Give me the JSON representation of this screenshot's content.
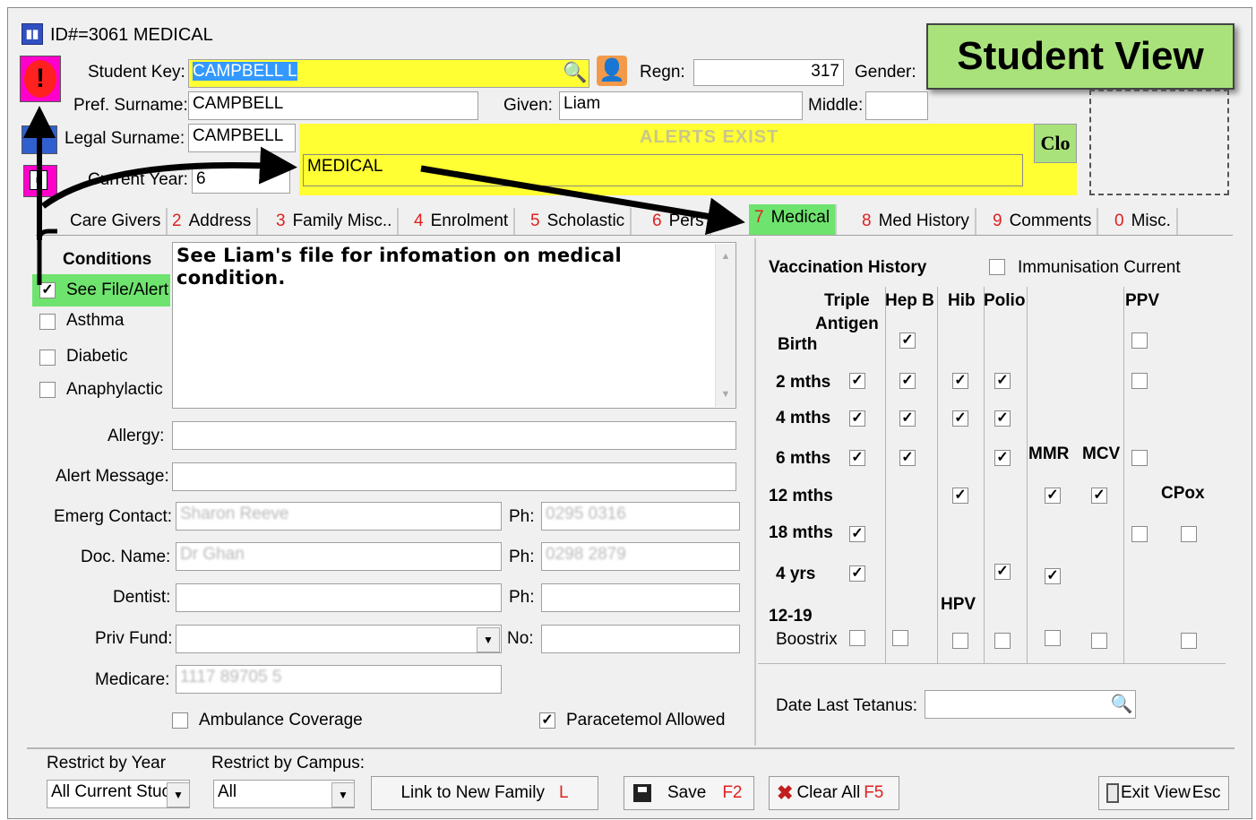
{
  "window": {
    "title": "ID#=3061 MEDICAL"
  },
  "callout": {
    "text": "Student View"
  },
  "header": {
    "student_key_label": "Student Key:",
    "student_key_value": "CAMPBELL L",
    "regn_label": "Regn:",
    "regn_value": "317",
    "gender_label": "Gender:",
    "pref_surname_label": "Pref. Surname:",
    "pref_surname_value": "CAMPBELL",
    "given_label": "Given:",
    "given_value": "Liam",
    "middle_label": "Middle:",
    "legal_surname_label": "Legal Surname:",
    "legal_surname_value": "CAMPBELL",
    "current_year_label": "Current Year:",
    "current_year_value": "6",
    "alerts_label": "ALERTS EXIST",
    "alert_value": "MEDICAL",
    "close_label": "Clo"
  },
  "tabs": [
    {
      "num": "",
      "label": "Care Givers"
    },
    {
      "num": "2",
      "label": "Address"
    },
    {
      "num": "3",
      "label": "Family Misc.."
    },
    {
      "num": "4",
      "label": "Enrolment"
    },
    {
      "num": "5",
      "label": "Scholastic"
    },
    {
      "num": "6",
      "label": "Pers"
    },
    {
      "num": "7",
      "label": "Medical"
    },
    {
      "num": "8",
      "label": "Med History"
    },
    {
      "num": "9",
      "label": "Comments"
    },
    {
      "num": "0",
      "label": "Misc."
    }
  ],
  "conditions": {
    "title": "Conditions",
    "notes": "See Liam's file for infomation on medical condition.",
    "items": [
      {
        "label": "See File/Alert",
        "checked": true
      },
      {
        "label": "Asthma",
        "checked": false
      },
      {
        "label": "Diabetic",
        "checked": false
      },
      {
        "label": "Anaphylactic",
        "checked": false
      }
    ]
  },
  "form": {
    "allergy_label": "Allergy:",
    "alert_message_label": "Alert Message:",
    "emerg_contact_label": "Emerg Contact:",
    "emerg_contact_value": "Sharon Reeve",
    "ph_label": "Ph:",
    "emerg_ph_value": "0295 0316",
    "doc_name_label": "Doc. Name:",
    "doc_name_value": "Dr Ghan",
    "doc_ph_value": "0298 2879",
    "dentist_label": "Dentist:",
    "priv_fund_label": "Priv Fund:",
    "no_label": "No:",
    "medicare_label": "Medicare:",
    "medicare_value": "1117 89705 5",
    "ambulance_label": "Ambulance Coverage",
    "paracetamol_label": "Paracetemol Allowed"
  },
  "vaccination": {
    "title": "Vaccination History",
    "immunisation_label": "Immunisation Current",
    "col_triple": "Triple",
    "col_antigen": "Antigen",
    "col_hepb": "Hep B",
    "col_hib": "Hib",
    "col_polio": "Polio",
    "col_ppv": "PPV",
    "col_mmr": "MMR",
    "col_mcv": "MCV",
    "col_cpox": "CPox",
    "col_hpv": "HPV",
    "rows": [
      "Birth",
      "2 mths",
      "4 mths",
      "6 mths",
      "12 mths",
      "18 mths",
      "4 yrs",
      "12-19"
    ],
    "boostrix": "Boostrix",
    "date_tetanus_label": "Date Last Tetanus:"
  },
  "footer": {
    "restrict_year_label": "Restrict by Year",
    "restrict_year_value": "All Current Stuc",
    "restrict_campus_label": "Restrict by Campus:",
    "restrict_campus_value": "All",
    "link_family": "Link to New Family",
    "link_key": "L",
    "save": "Save",
    "save_key": "F2",
    "clear_all": "Clear All",
    "clear_key": "F5",
    "exit": "Exit View",
    "exit_key": "Esc"
  },
  "colors": {
    "alert_yellow": "#ffff33",
    "callout_green": "#a9e27a",
    "tab_active": "#6ee36e",
    "key_red": "#e02020"
  }
}
